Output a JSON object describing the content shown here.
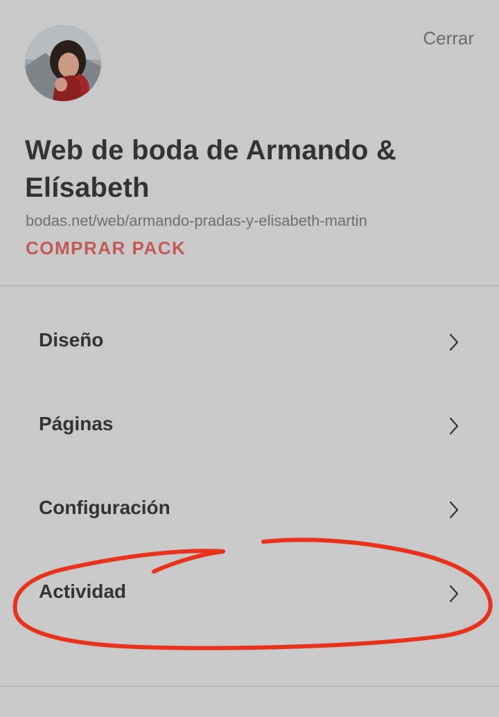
{
  "header": {
    "close_label": "Cerrar",
    "avatar_icon": "profile-photo"
  },
  "site": {
    "title": "Web de boda de Armando & Elísabeth",
    "url": "bodas.net/web/armando-pradas-y-elisabeth-martin",
    "buy_label": "COMPRAR PACK"
  },
  "menu": {
    "items": [
      {
        "label": "Diseño",
        "icon": "chevron-right-icon"
      },
      {
        "label": "Páginas",
        "icon": "chevron-right-icon"
      },
      {
        "label": "Configuración",
        "icon": "chevron-right-icon"
      },
      {
        "label": "Actividad",
        "icon": "chevron-right-icon"
      }
    ]
  },
  "colors": {
    "background": "#c9c9c9",
    "accent": "#c45a56",
    "annotation": "#e8321c"
  }
}
